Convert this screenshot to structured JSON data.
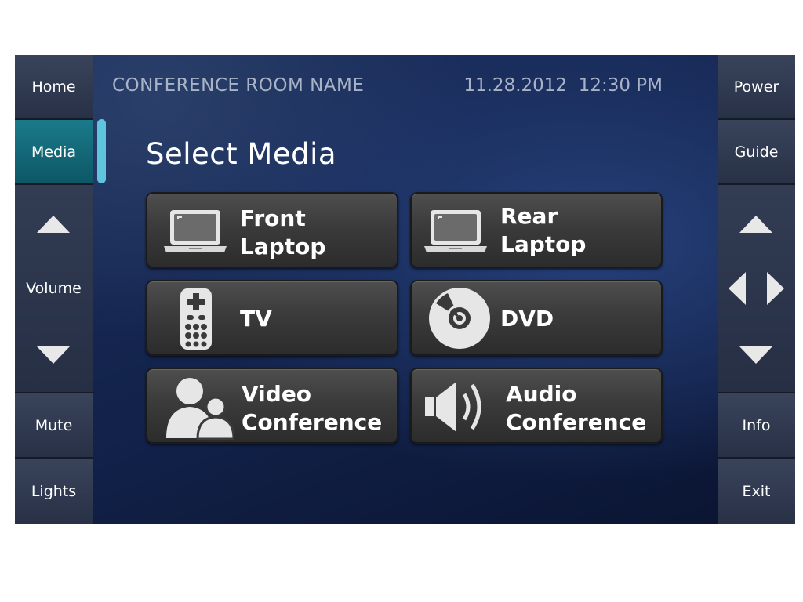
{
  "header": {
    "room_name": "CONFERENCE ROOM NAME",
    "date": "11.28.2012",
    "time": "12:30 PM"
  },
  "left_nav": {
    "home": "Home",
    "media": "Media",
    "volume": "Volume",
    "mute": "Mute",
    "lights": "Lights"
  },
  "right_nav": {
    "power": "Power",
    "guide": "Guide",
    "info": "Info",
    "exit": "Exit"
  },
  "main": {
    "heading": "Select Media",
    "sources": [
      {
        "line1": "Front",
        "line2": "Laptop",
        "icon": "laptop-icon"
      },
      {
        "line1": "Rear",
        "line2": "Laptop",
        "icon": "laptop-icon"
      },
      {
        "line1": "TV",
        "line2": "",
        "icon": "remote-icon"
      },
      {
        "line1": "DVD",
        "line2": "",
        "icon": "disc-icon"
      },
      {
        "line1": "Video",
        "line2": "Conference",
        "icon": "people-icon"
      },
      {
        "line1": "Audio",
        "line2": "Conference",
        "icon": "speaker-icon"
      }
    ]
  },
  "colors": {
    "active_nav": "#1a7a8a",
    "indicator": "#5fc4dd",
    "header_text": "#a9b3c8"
  }
}
